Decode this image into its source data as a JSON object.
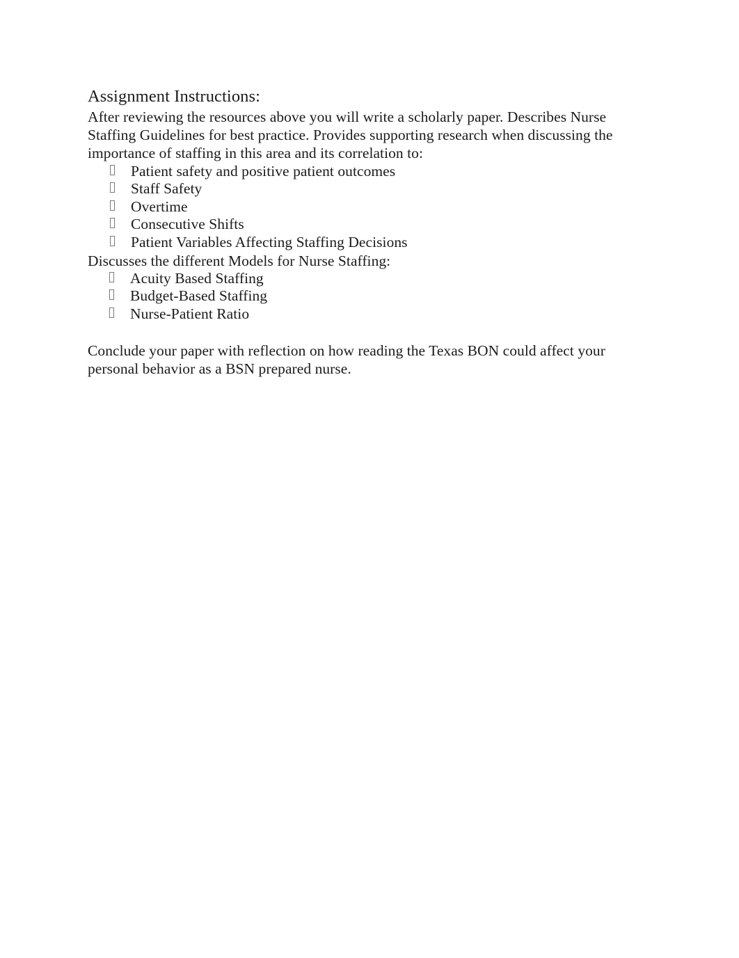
{
  "document": {
    "heading": "Assignment Instructions:",
    "intro_paragraph": "After reviewing the resources above you will write a scholarly paper. Describes Nurse Staffing Guidelines for best practice. Provides supporting research when discussing the importance of staffing in this area and its correlation to:",
    "correlation_list": {
      "bullet_glyph": "missing-glyph-box",
      "items": [
        "Patient safety and positive patient outcomes",
        "Staff Safety",
        "Overtime",
        "Consecutive Shifts",
        "Patient Variables Affecting Staffing Decisions"
      ]
    },
    "models_paragraph": "Discusses the different Models for Nurse Staffing:",
    "models_list": {
      "bullet_glyph": "missing-glyph-box",
      "items": [
        "Acuity Based Staffing",
        "Budget-Based Staffing",
        "Nurse-Patient Ratio"
      ]
    },
    "conclusion_paragraph": "Conclude your paper with reflection on how reading the Texas BON could affect your personal behavior as a BSN prepared nurse."
  },
  "colors": {
    "page_background": "#ffffff",
    "text": "#1b1b1b",
    "bullet_box_border": "#7a7a7a"
  }
}
